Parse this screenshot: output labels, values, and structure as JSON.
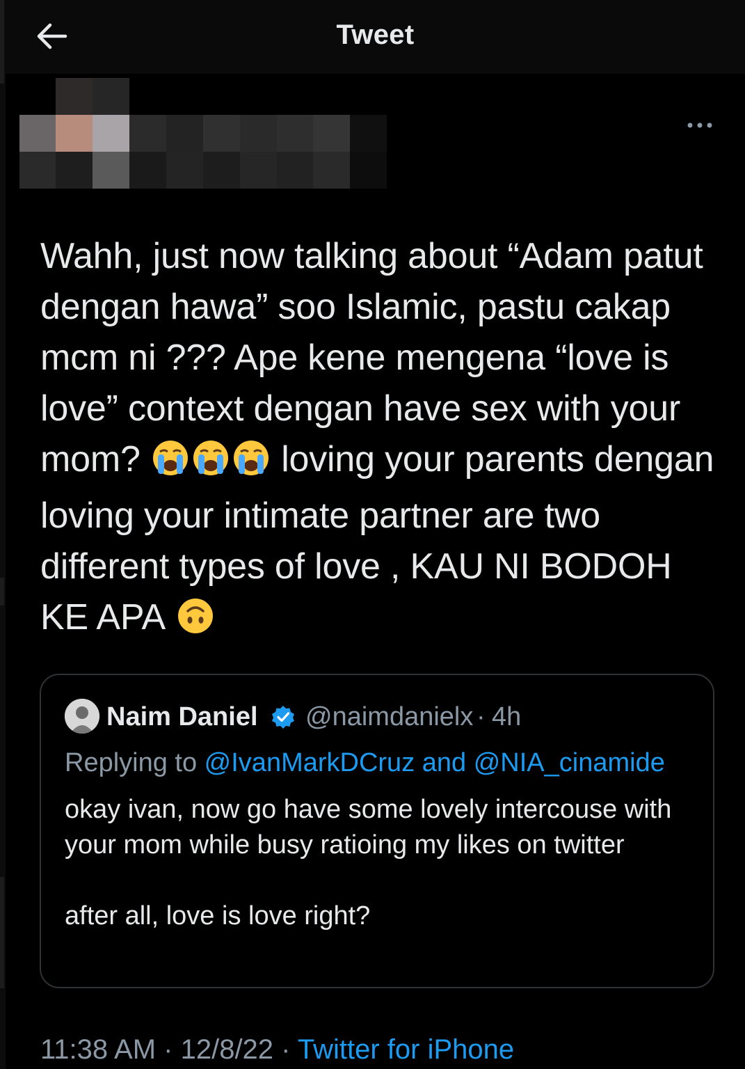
{
  "header": {
    "title": "Tweet"
  },
  "tweet": {
    "text_parts": {
      "line_a": "Wahh, just now talking about “Adam patut dengan hawa” soo Islamic, pastu cakap mcm ni ??? Ape kene mengena “love is love” context dengan have sex with your mom?",
      "line_b": "loving your parents dengan loving your intimate partner are two different types of love , KAU NI BODOH KE APA"
    },
    "emoji_sequence": [
      "loudly-crying-face",
      "loudly-crying-face",
      "loudly-crying-face"
    ],
    "end_emoji": "upside-down-face"
  },
  "quote": {
    "name": "Naim Daniel",
    "handle": "@naimdanielx",
    "separator": "·",
    "time": "4h",
    "replying_prefix": "Replying to ",
    "replying_user_1": "@IvanMarkDCruz",
    "replying_and": " and ",
    "replying_user_2": "@NIA_cinamide",
    "body_line_1": "okay ivan, now go have some lovely intercouse with your mom while busy ratioing my likes on twitter",
    "body_line_2": "after all, love is love right?"
  },
  "footer": {
    "time": "11:38 AM",
    "sep1": " · ",
    "date": "12/8/22",
    "sep2": " · ",
    "source": "Twitter for iPhone"
  },
  "colors": {
    "background": "#000000",
    "text": "#e7e9ea",
    "muted": "#8b98a5",
    "link": "#1d9bf0",
    "border": "#2f3336"
  },
  "icons": {
    "back": "arrow-left-icon",
    "more": "more-horizontal-icon",
    "verified": "verified-badge-icon"
  }
}
